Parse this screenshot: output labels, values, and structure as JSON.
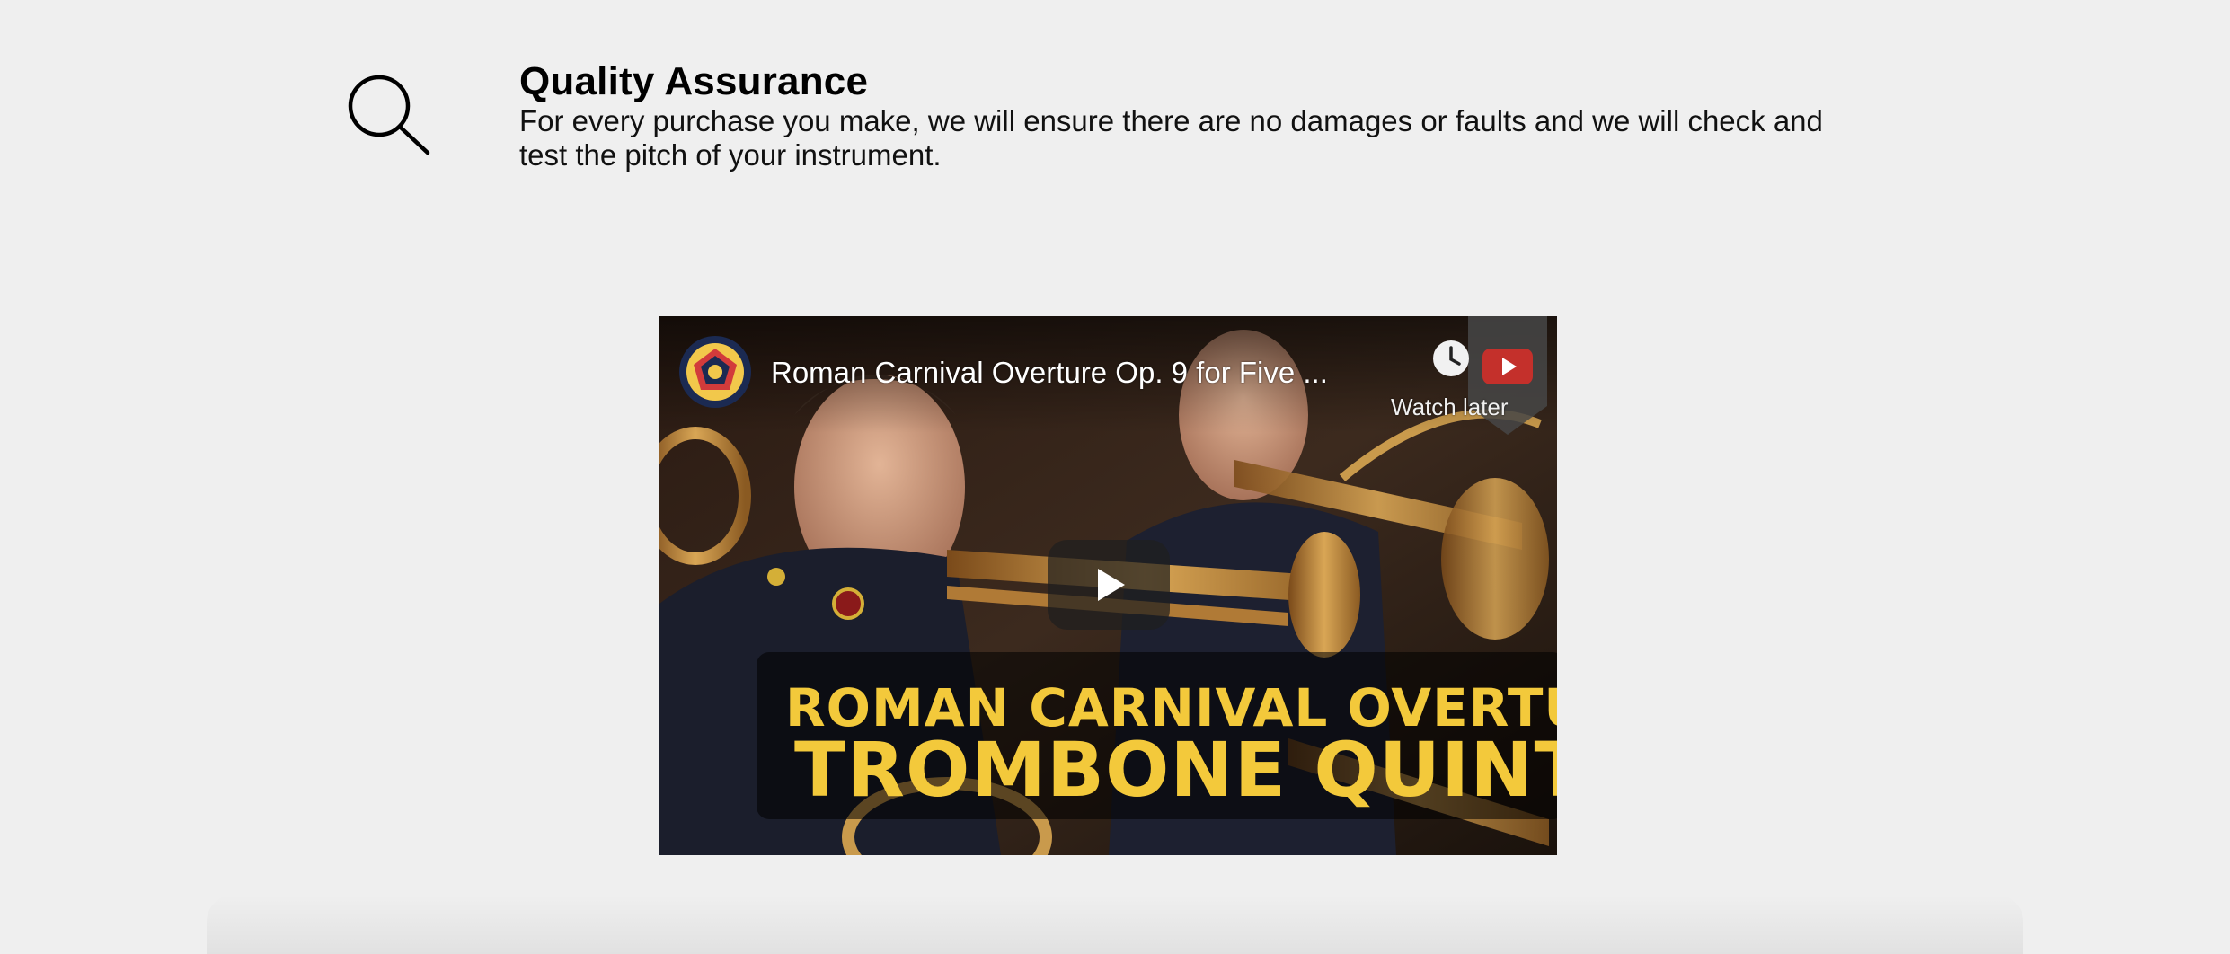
{
  "feature": {
    "icon": "magnifier-icon",
    "title": "Quality Assurance",
    "description": "For every purchase you make, we will ensure there are no damages or faults and we will check and test the pitch of your instrument."
  },
  "video": {
    "title": "Roman Carnival Overture Op. 9 for Five ...",
    "watch_later_label": "Watch later",
    "thumbnail_banner": {
      "line1": "ROMAN CARNIVAL OVERTURE",
      "line2": "TROMBONE QUINTET"
    },
    "icons": {
      "channel": "channel-logo-icon",
      "watch_later": "clock-icon",
      "youtube": "youtube-icon",
      "play": "play-icon"
    },
    "colors": {
      "banner_text": "#f3c93b",
      "youtube_red": "#c4302b"
    }
  }
}
